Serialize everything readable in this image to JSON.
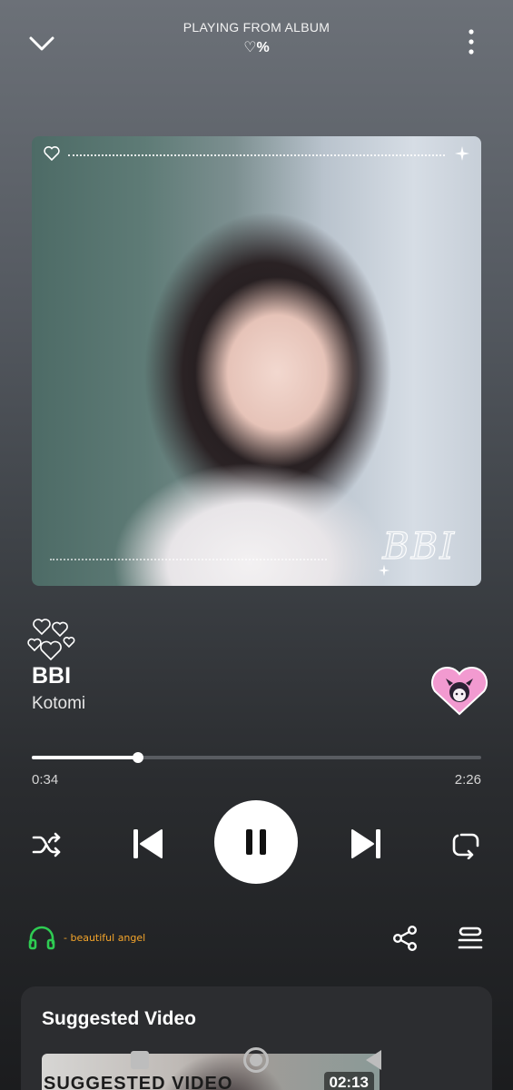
{
  "header": {
    "context_label": "PLAYING FROM ALBUM",
    "album_name": "♡%"
  },
  "album_art": {
    "overlay_text": "BBI"
  },
  "track": {
    "title": "BBI",
    "artist": "Kotomi"
  },
  "progress": {
    "elapsed": "0:34",
    "total": "2:26",
    "fraction": 0.237
  },
  "controls": {
    "shuffle": "shuffle-icon",
    "previous": "skip-previous-icon",
    "play_pause": "pause-icon",
    "next": "skip-next-icon",
    "repeat": "repeat-icon"
  },
  "output_device": {
    "icon": "headphones-icon",
    "label": "- beautiful angel",
    "icon_color": "#2ecc52",
    "label_color": "#f4a52b"
  },
  "suggested": {
    "heading": "Suggested Video",
    "video": {
      "thumbnail_text": "SUGGESTED VIDEO",
      "duration": "02:13"
    }
  },
  "colors": {
    "background_top": "#6c7178",
    "background_bottom": "#1b1c1e",
    "card": "#2c2d30"
  }
}
